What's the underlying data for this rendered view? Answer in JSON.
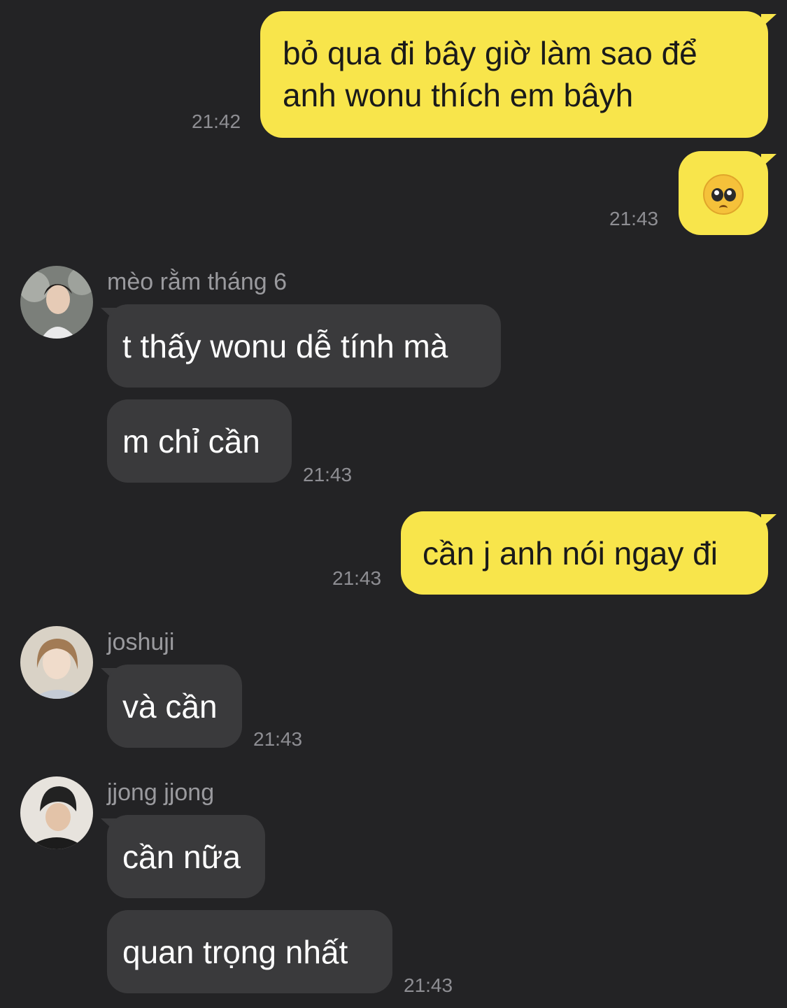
{
  "messages": [
    {
      "dir": "out",
      "text": "bỏ qua đi bây giờ làm sao để\nanh wonu thích em bâyh",
      "time": "21:42"
    },
    {
      "dir": "out",
      "emoji": "pleading-face",
      "time": "21:43"
    },
    {
      "dir": "in",
      "sender": "mèo rằm tháng 6",
      "texts": [
        "t thấy wonu dễ tính mà",
        "m chỉ cần"
      ],
      "time": "21:43"
    },
    {
      "dir": "out",
      "text": "cần j anh nói ngay đi",
      "time": "21:43"
    },
    {
      "dir": "in",
      "sender": "joshuji",
      "texts": [
        "và cần"
      ],
      "time": "21:43"
    },
    {
      "dir": "in",
      "sender": "jjong jjong",
      "texts": [
        "cần nữa",
        "quan trọng nhất"
      ],
      "time": "21:43"
    }
  ],
  "colors": {
    "background": "#232325",
    "outgoing_bubble": "#f8e54b",
    "incoming_bubble": "#3a3a3c",
    "timestamp": "#8e8e93"
  }
}
